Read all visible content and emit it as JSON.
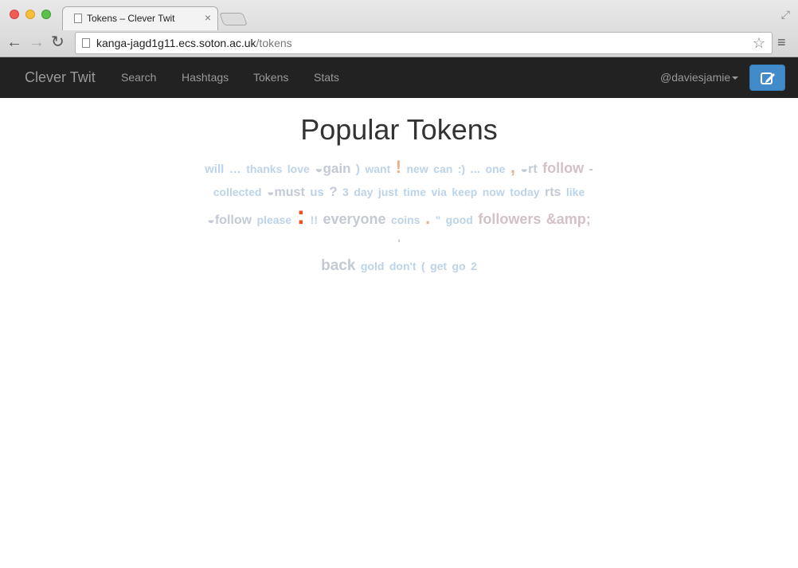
{
  "browser": {
    "tab_title": "Tokens – Clever Twit",
    "url_host": "kanga-jagd1g11.ecs.soton.ac.uk",
    "url_path": "/tokens"
  },
  "navbar": {
    "brand": "Clever Twit",
    "links": [
      "Search",
      "Hashtags",
      "Tokens",
      "Stats"
    ],
    "user": "@daviesjamie"
  },
  "page": {
    "title": "Popular Tokens"
  },
  "tokens": [
    "will",
    "…",
    "thanks",
    "love",
    "◒gain",
    ")",
    "want",
    "!",
    "new",
    "can",
    ":)",
    "...",
    "one",
    ",",
    "◒rt",
    "follow",
    "-",
    "collected",
    "◒must",
    "us",
    "?",
    "3",
    "day",
    "just",
    "time",
    "via",
    "keep",
    "now",
    "today",
    "rts",
    "like",
    "◒follow",
    "please",
    ":",
    "!!",
    "everyone",
    "coins",
    ".",
    "\"",
    "good",
    "followers",
    "&amp;",
    "'",
    "back",
    "gold",
    "don't",
    "(",
    "get",
    "go",
    "2"
  ],
  "colors": {
    "navbar_bg": "#222222",
    "compose_button": "#428bca",
    "token_hot": "#f25022",
    "token_cool": "#bcd3e8"
  }
}
